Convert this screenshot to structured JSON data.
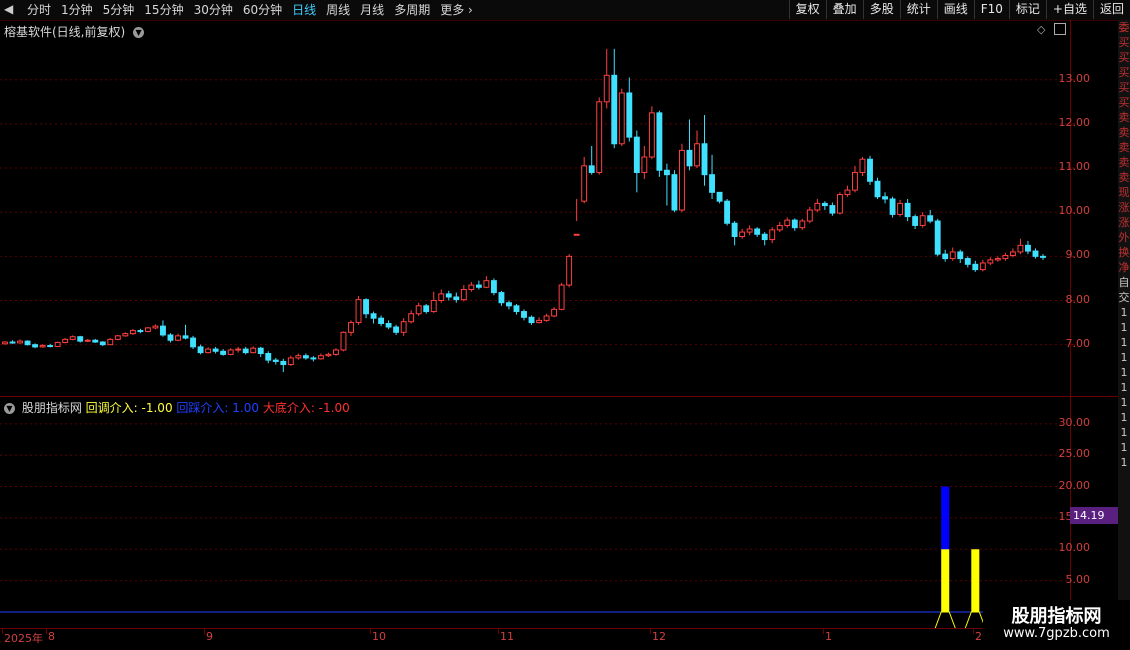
{
  "toolbar": {
    "periods": [
      "分时",
      "1分钟",
      "5分钟",
      "15分钟",
      "30分钟",
      "60分钟",
      "日线",
      "周线",
      "月线",
      "多周期",
      "更多"
    ],
    "active": "日线",
    "right_buttons": [
      "复权",
      "叠加",
      "多股",
      "统计",
      "画线",
      "F10",
      "标记",
      "+自选",
      "返回"
    ]
  },
  "chart_title": "榕基软件(日线,前复权)",
  "price_axis": [
    "13.00",
    "12.00",
    "11.00",
    "10.00",
    "9.00",
    "8.00",
    "7.00"
  ],
  "indicator": {
    "name": "股朋指标网",
    "items": [
      {
        "label": "回调介入: -1.00",
        "color": "#ffff40"
      },
      {
        "label": "回踩介入: 1.00",
        "color": "#2040ff"
      },
      {
        "label": "大底介入: -1.00",
        "color": "#ff3030"
      }
    ],
    "axis": [
      "30.00",
      "25.00",
      "20.00",
      "15.00",
      "10.00",
      "5.00"
    ],
    "current_value": "14.19"
  },
  "x_axis": [
    "2025年",
    "8",
    "9",
    "10",
    "11",
    "12",
    "1",
    "2"
  ],
  "right_strip": [
    "委",
    "买",
    "买",
    "买",
    "买",
    "买",
    "卖",
    "卖",
    "卖",
    "卖",
    "卖",
    "现",
    "涨",
    "涨",
    "外",
    "换",
    "净",
    "自",
    "交",
    "1",
    "1",
    "1",
    "1",
    "1",
    "1",
    "1",
    "1",
    "1",
    "1",
    "1"
  ],
  "watermark": {
    "title": "股朋指标网",
    "url": "www.7gpzb.com"
  },
  "colors": {
    "up": "#ff4040",
    "down": "#40e0ff",
    "grid": "#5a0000",
    "bg": "#000000"
  },
  "chart_data": {
    "type": "candlestick",
    "y_min": 6.2,
    "y_max": 13.9,
    "candles": [
      [
        7.02,
        7.06,
        7.08,
        7.0
      ],
      [
        7.06,
        7.04,
        7.1,
        7.02
      ],
      [
        7.04,
        7.08,
        7.12,
        7.02
      ],
      [
        7.08,
        7.0,
        7.1,
        6.98
      ],
      [
        7.0,
        6.95,
        7.03,
        6.92
      ],
      [
        6.95,
        6.98,
        7.01,
        6.93
      ],
      [
        6.98,
        6.96,
        7.02,
        6.94
      ],
      [
        6.96,
        7.05,
        7.07,
        6.95
      ],
      [
        7.05,
        7.12,
        7.15,
        7.03
      ],
      [
        7.12,
        7.18,
        7.21,
        7.1
      ],
      [
        7.18,
        7.08,
        7.2,
        7.05
      ],
      [
        7.08,
        7.1,
        7.13,
        7.06
      ],
      [
        7.1,
        7.06,
        7.13,
        7.04
      ],
      [
        7.06,
        7.0,
        7.08,
        6.97
      ],
      [
        7.0,
        7.12,
        7.15,
        6.99
      ],
      [
        7.12,
        7.2,
        7.22,
        7.1
      ],
      [
        7.2,
        7.25,
        7.28,
        7.18
      ],
      [
        7.25,
        7.32,
        7.35,
        7.22
      ],
      [
        7.32,
        7.3,
        7.36,
        7.26
      ],
      [
        7.3,
        7.38,
        7.4,
        7.28
      ],
      [
        7.38,
        7.42,
        7.46,
        7.35
      ],
      [
        7.42,
        7.22,
        7.55,
        7.18
      ],
      [
        7.22,
        7.1,
        7.26,
        7.05
      ],
      [
        7.1,
        7.2,
        7.25,
        7.08
      ],
      [
        7.2,
        7.15,
        7.45,
        7.12
      ],
      [
        7.15,
        6.95,
        7.2,
        6.9
      ],
      [
        6.95,
        6.82,
        7.0,
        6.78
      ],
      [
        6.82,
        6.9,
        6.94,
        6.8
      ],
      [
        6.9,
        6.85,
        6.95,
        6.8
      ],
      [
        6.85,
        6.78,
        6.9,
        6.75
      ],
      [
        6.78,
        6.88,
        6.92,
        6.76
      ],
      [
        6.88,
        6.9,
        6.95,
        6.82
      ],
      [
        6.9,
        6.82,
        6.95,
        6.78
      ],
      [
        6.82,
        6.92,
        6.96,
        6.8
      ],
      [
        6.92,
        6.8,
        6.95,
        6.72
      ],
      [
        6.8,
        6.65,
        6.85,
        6.58
      ],
      [
        6.65,
        6.62,
        6.7,
        6.55
      ],
      [
        6.62,
        6.55,
        6.68,
        6.38
      ],
      [
        6.55,
        6.7,
        6.75,
        6.52
      ],
      [
        6.7,
        6.75,
        6.8,
        6.66
      ],
      [
        6.75,
        6.7,
        6.8,
        6.66
      ],
      [
        6.7,
        6.68,
        6.74,
        6.62
      ],
      [
        6.68,
        6.75,
        6.8,
        6.66
      ],
      [
        6.75,
        6.78,
        6.82,
        6.72
      ],
      [
        6.78,
        6.88,
        6.92,
        6.75
      ],
      [
        6.88,
        7.28,
        7.3,
        6.85
      ],
      [
        7.28,
        7.5,
        7.55,
        7.2
      ],
      [
        7.5,
        8.02,
        8.1,
        7.45
      ],
      [
        8.02,
        7.7,
        8.05,
        7.6
      ],
      [
        7.7,
        7.6,
        7.75,
        7.48
      ],
      [
        7.6,
        7.48,
        7.66,
        7.42
      ],
      [
        7.48,
        7.4,
        7.55,
        7.35
      ],
      [
        7.4,
        7.28,
        7.45,
        7.22
      ],
      [
        7.28,
        7.52,
        7.6,
        7.2
      ],
      [
        7.52,
        7.7,
        7.78,
        7.48
      ],
      [
        7.7,
        7.88,
        7.95,
        7.65
      ],
      [
        7.88,
        7.75,
        7.92,
        7.7
      ],
      [
        7.75,
        8.0,
        8.2,
        7.72
      ],
      [
        8.0,
        8.15,
        8.25,
        7.95
      ],
      [
        8.15,
        8.08,
        8.22,
        8.0
      ],
      [
        8.08,
        8.02,
        8.18,
        7.95
      ],
      [
        8.02,
        8.25,
        8.35,
        7.98
      ],
      [
        8.25,
        8.35,
        8.42,
        8.2
      ],
      [
        8.35,
        8.3,
        8.45,
        8.25
      ],
      [
        8.3,
        8.45,
        8.55,
        8.28
      ],
      [
        8.45,
        8.18,
        8.5,
        8.12
      ],
      [
        8.18,
        7.95,
        8.22,
        7.88
      ],
      [
        7.95,
        7.88,
        8.0,
        7.8
      ],
      [
        7.88,
        7.75,
        7.92,
        7.68
      ],
      [
        7.75,
        7.62,
        7.8,
        7.55
      ],
      [
        7.62,
        7.5,
        7.66,
        7.45
      ],
      [
        7.5,
        7.55,
        7.62,
        7.48
      ],
      [
        7.55,
        7.65,
        7.7,
        7.52
      ],
      [
        7.65,
        7.8,
        7.85,
        7.62
      ],
      [
        7.8,
        8.35,
        8.4,
        7.78
      ],
      [
        8.35,
        9.0,
        9.05,
        8.3
      ],
      [
        9.5,
        9.5,
        10.3,
        9.8
      ],
      [
        10.25,
        11.05,
        11.25,
        10.2
      ],
      [
        11.05,
        10.9,
        11.5,
        10.85
      ],
      [
        10.9,
        12.5,
        12.6,
        10.85
      ],
      [
        12.5,
        13.1,
        13.7,
        12.35
      ],
      [
        13.1,
        11.55,
        13.7,
        11.45
      ],
      [
        11.55,
        12.7,
        12.8,
        11.5
      ],
      [
        12.7,
        11.7,
        13.05,
        11.6
      ],
      [
        11.7,
        10.9,
        11.85,
        10.45
      ],
      [
        10.9,
        11.25,
        11.5,
        10.75
      ],
      [
        11.25,
        12.25,
        12.4,
        11.2
      ],
      [
        12.25,
        10.95,
        12.3,
        10.8
      ],
      [
        10.95,
        10.85,
        11.1,
        10.15
      ],
      [
        10.85,
        10.05,
        10.95,
        10.0
      ],
      [
        10.05,
        11.4,
        11.55,
        10.0
      ],
      [
        11.4,
        11.05,
        12.1,
        10.95
      ],
      [
        11.05,
        11.55,
        11.85,
        11.0
      ],
      [
        11.55,
        10.85,
        12.2,
        10.6
      ],
      [
        10.85,
        10.45,
        11.3,
        10.3
      ],
      [
        10.45,
        10.25,
        10.4,
        10.2
      ],
      [
        10.25,
        9.75,
        10.3,
        9.7
      ],
      [
        9.75,
        9.45,
        9.8,
        9.25
      ],
      [
        9.45,
        9.55,
        9.62,
        9.4
      ],
      [
        9.55,
        9.62,
        9.7,
        9.48
      ],
      [
        9.62,
        9.5,
        9.66,
        9.44
      ],
      [
        9.5,
        9.38,
        9.55,
        9.25
      ],
      [
        9.38,
        9.6,
        9.66,
        9.3
      ],
      [
        9.6,
        9.7,
        9.78,
        9.55
      ],
      [
        9.7,
        9.82,
        9.88,
        9.65
      ],
      [
        9.82,
        9.65,
        9.86,
        9.58
      ],
      [
        9.65,
        9.8,
        9.85,
        9.6
      ],
      [
        9.8,
        10.05,
        10.12,
        9.75
      ],
      [
        10.05,
        10.2,
        10.3,
        10.0
      ],
      [
        10.2,
        10.15,
        10.25,
        10.05
      ],
      [
        10.15,
        9.98,
        10.22,
        9.92
      ],
      [
        9.98,
        10.4,
        10.45,
        9.95
      ],
      [
        10.4,
        10.5,
        10.6,
        10.35
      ],
      [
        10.5,
        10.9,
        11.05,
        10.45
      ],
      [
        10.9,
        11.2,
        11.25,
        10.82
      ],
      [
        11.2,
        10.7,
        11.28,
        10.62
      ],
      [
        10.7,
        10.35,
        10.78,
        10.3
      ],
      [
        10.35,
        10.3,
        10.45,
        10.2
      ],
      [
        10.3,
        9.95,
        10.35,
        9.88
      ],
      [
        9.95,
        10.2,
        10.28,
        9.9
      ],
      [
        10.2,
        9.9,
        10.3,
        9.8
      ],
      [
        9.9,
        9.7,
        9.95,
        9.62
      ],
      [
        9.7,
        9.92,
        10.0,
        9.65
      ],
      [
        9.92,
        9.8,
        10.05,
        9.75
      ],
      [
        9.8,
        9.05,
        9.85,
        9.0
      ],
      [
        9.05,
        8.95,
        9.15,
        8.88
      ],
      [
        8.95,
        9.1,
        9.2,
        8.9
      ],
      [
        9.1,
        8.95,
        9.15,
        8.85
      ],
      [
        8.95,
        8.82,
        9.0,
        8.75
      ],
      [
        8.82,
        8.7,
        8.9,
        8.65
      ],
      [
        8.7,
        8.85,
        8.92,
        8.66
      ],
      [
        8.85,
        8.92,
        8.98,
        8.8
      ],
      [
        8.92,
        8.95,
        9.0,
        8.88
      ],
      [
        8.95,
        9.02,
        9.08,
        8.9
      ],
      [
        9.02,
        9.1,
        9.18,
        8.98
      ],
      [
        9.1,
        9.25,
        9.4,
        9.05
      ],
      [
        9.25,
        9.12,
        9.35,
        9.05
      ],
      [
        9.12,
        9.0,
        9.18,
        8.95
      ],
      [
        9.0,
        8.98,
        9.05,
        8.92
      ]
    ],
    "indicator_series": [
      {
        "name": "回调介入",
        "color": "#ffff00",
        "bars": [
          {
            "candle": 125,
            "value": 10
          },
          {
            "candle": 129,
            "value": 10
          },
          {
            "candle": 162,
            "value": 10
          }
        ]
      },
      {
        "name": "回踩介入",
        "color": "#0000ff",
        "bars": [
          {
            "candle": 125,
            "value": 20
          }
        ]
      }
    ],
    "indicator_ylim": [
      0,
      33
    ]
  }
}
